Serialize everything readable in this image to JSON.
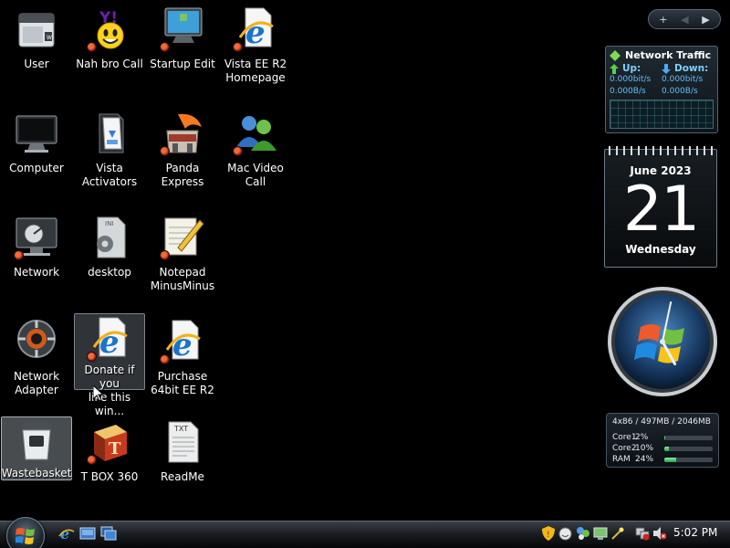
{
  "desktop": {
    "icons": [
      {
        "label": "User",
        "icon": "user-folder-icon"
      },
      {
        "label": "Nah bro Call",
        "icon": "yahoo-messenger-icon"
      },
      {
        "label": "Startup Edit",
        "icon": "startup-monitor-icon"
      },
      {
        "label": "Vista EE R2\nHomepage",
        "icon": "internet-explorer-icon"
      },
      {
        "label": "Computer",
        "icon": "computer-monitor-icon"
      },
      {
        "label": "Vista\nActivators",
        "icon": "folder-activators-icon"
      },
      {
        "label": "Panda Express",
        "icon": "panda-express-icon"
      },
      {
        "label": "Mac Video\nCall",
        "icon": "video-call-people-icon"
      },
      {
        "label": "Network",
        "icon": "network-satellite-icon"
      },
      {
        "label": "desktop",
        "icon": "ini-settings-file-icon"
      },
      {
        "label": "Notepad\nMinusMinus",
        "icon": "notepad-icon"
      },
      {
        "label": "Network\nAdapter",
        "icon": "network-adapter-icon"
      },
      {
        "label": "Donate if you\nlike this win...",
        "icon": "internet-explorer-document-icon"
      },
      {
        "label": "Purchase\n64bit EE R2",
        "icon": "internet-explorer-document-icon"
      },
      {
        "label": "Wastebasket",
        "icon": "recycle-bin-icon"
      },
      {
        "label": "T BOX 360",
        "icon": "tbox-icon"
      },
      {
        "label": "ReadMe",
        "icon": "txt-file-icon"
      }
    ]
  },
  "gadgets": {
    "controls": {
      "add": "+",
      "prev": "◀",
      "next": "▶"
    },
    "network": {
      "title": "Network Traffic",
      "up_label": "Up:",
      "down_label": "Down:",
      "up_bits": "0.000bit/s",
      "up_bytes": "0.000B/s",
      "down_bits": "0.000bit/s",
      "down_bytes": "0.000B/s"
    },
    "calendar": {
      "month": "June 2023",
      "day": "21",
      "weekday": "Wednesday"
    },
    "clock": {
      "hour": 5,
      "minute": 2
    },
    "cpu": {
      "header": "4x86 / 497MB / 2046MB",
      "rows": [
        {
          "name": "Core1",
          "percent": "2%",
          "value": 2
        },
        {
          "name": "Core2",
          "percent": "10%",
          "value": 10
        },
        {
          "name": "RAM",
          "percent": "24%",
          "value": 24
        }
      ]
    }
  },
  "taskbar": {
    "clock": "5:02 PM",
    "quick_launch": [
      "internet-explorer-icon",
      "show-desktop-icon",
      "switch-windows-icon"
    ],
    "tray": [
      "security-shield-icon",
      "messenger-icon",
      "network-icon",
      "display-icon",
      "wand-icon",
      "network-status-icon",
      "volume-muted-icon"
    ]
  },
  "colors": {
    "accent": "#5fc0ff",
    "selection": "#9aa4ae"
  }
}
